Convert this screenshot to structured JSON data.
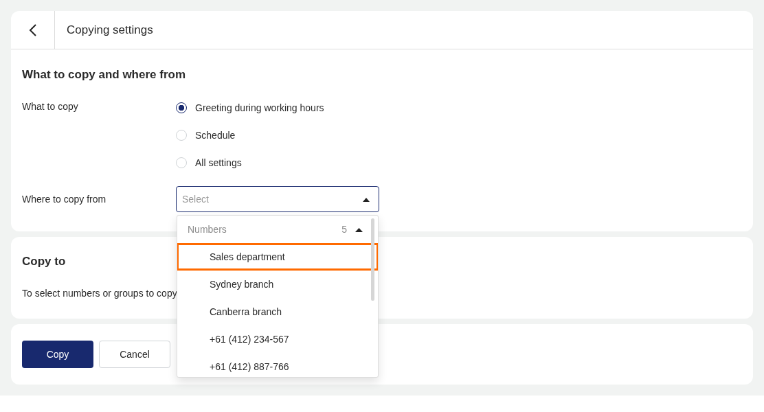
{
  "header": {
    "title": "Copying settings"
  },
  "source_section": {
    "title": "What to copy and where from",
    "what_label": "What to copy",
    "options": [
      {
        "label": "Greeting during working hours",
        "selected": true
      },
      {
        "label": "Schedule",
        "selected": false
      },
      {
        "label": "All settings",
        "selected": false
      }
    ],
    "where_label": "Where to copy from",
    "select": {
      "placeholder": "Select",
      "expanded": true,
      "group": {
        "label": "Numbers",
        "count": "5",
        "expanded": true
      },
      "items": [
        {
          "label": "Sales department",
          "highlighted": true
        },
        {
          "label": "Sydney branch",
          "highlighted": false
        },
        {
          "label": "Canberra branch",
          "highlighted": false
        },
        {
          "label": "+61 (412) 234-567",
          "highlighted": false
        },
        {
          "label": "+61 (412) 887-766",
          "highlighted": false
        }
      ]
    }
  },
  "target_section": {
    "title": "Copy to",
    "hint": "To select numbers or groups to copy"
  },
  "buttons": [
    {
      "label": "Copy",
      "kind": "primary"
    },
    {
      "label": "Cancel",
      "kind": "secondary"
    }
  ]
}
